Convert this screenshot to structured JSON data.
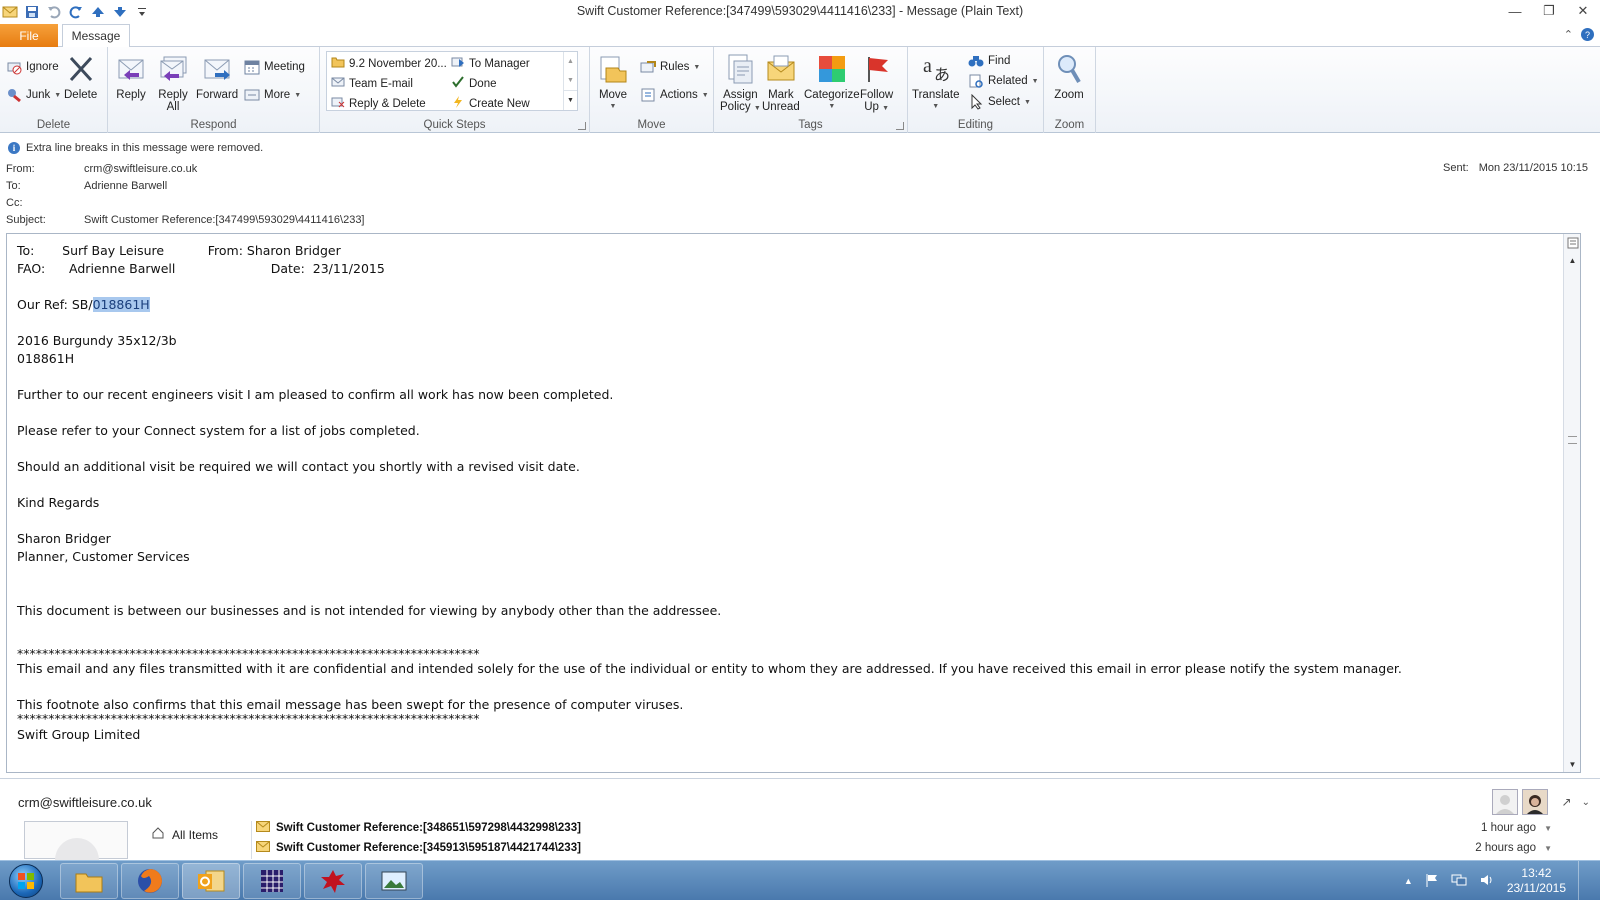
{
  "window": {
    "title": "Swift Customer Reference:[347499\\593029\\4411416\\233]  -  Message (Plain Text)"
  },
  "tabs": {
    "file": "File",
    "message": "Message"
  },
  "ribbon": {
    "delete_group": {
      "label": "Delete",
      "ignore": "Ignore",
      "junk": "Junk",
      "delete": "Delete"
    },
    "respond_group": {
      "label": "Respond",
      "reply": "Reply",
      "reply_all_1": "Reply",
      "reply_all_2": "All",
      "forward": "Forward",
      "meeting": "Meeting",
      "more": "More"
    },
    "quick_steps": {
      "label": "Quick Steps",
      "items": [
        "9.2 November 20...",
        "To Manager",
        "Team E-mail",
        "Done",
        "Reply & Delete",
        "Create New"
      ]
    },
    "move_group": {
      "label": "Move",
      "move": "Move",
      "rules": "Rules",
      "actions": "Actions"
    },
    "tags_group": {
      "label": "Tags",
      "assign_1": "Assign",
      "assign_2": "Policy",
      "mark_1": "Mark",
      "mark_2": "Unread",
      "categorize": "Categorize",
      "follow_1": "Follow",
      "follow_2": "Up"
    },
    "editing_group": {
      "label": "Editing",
      "translate": "Translate",
      "find": "Find",
      "related": "Related",
      "select": "Select"
    },
    "zoom_group": {
      "label": "Zoom",
      "zoom": "Zoom"
    }
  },
  "header": {
    "info": "Extra line breaks in this message were removed.",
    "from_label": "From:",
    "from": "crm@swiftleisure.co.uk",
    "to_label": "To:",
    "to": "Adrienne Barwell",
    "cc_label": "Cc:",
    "cc": "",
    "subject_label": "Subject:",
    "subject": "Swift Customer Reference:[347499\\593029\\4411416\\233]",
    "sent_label": "Sent:",
    "sent": "Mon 23/11/2015 10:15"
  },
  "body": {
    "line_to": "To:       Surf Bay Leisure           From: Sharon Bridger",
    "line_fao": "FAO:      Adrienne Barwell                        Date:  23/11/2015",
    "ref_prefix": "Our Ref: SB/",
    "ref_selected": "018861H",
    "model": "2016 Burgundy 35x12/3b",
    "model_ref": "018861H",
    "p1": "Further to our recent engineers visit I am pleased to confirm all work has now been completed.",
    "p2": "Please refer to your Connect system for a list of jobs completed.",
    "p3": "Should an additional visit be required we will contact you shortly with a revised visit date.",
    "regards": "Kind Regards",
    "sig_name": "Sharon Bridger",
    "sig_title": "Planner, Customer Services",
    "disclaimer": "This document is between our businesses and is not intended for viewing by anybody other than the addressee.",
    "stars": "**************************************************************************",
    "conf": "This email and any files transmitted with it are confidential and intended solely for the use of the individual or entity to whom they are addressed. If you have received this email in error please notify the system manager.",
    "virus": "This footnote also confirms that this email message has been swept for the presence of computer viruses.",
    "company": "Swift Group Limited"
  },
  "people_pane": {
    "email": "crm@swiftleisure.co.uk",
    "nav_all": "All Items",
    "items": [
      {
        "subject": "Swift Customer Reference:[348651\\597298\\4432998\\233]",
        "time": "1 hour ago"
      },
      {
        "subject": "Swift Customer Reference:[345913\\595187\\4421744\\233]",
        "time": "2 hours ago"
      }
    ]
  },
  "taskbar": {
    "time": "13:42",
    "date": "23/11/2015"
  },
  "colors": {
    "file_tab": "#e77c11",
    "selection": "#a8c8ee",
    "taskbar": "#4a79ad"
  }
}
